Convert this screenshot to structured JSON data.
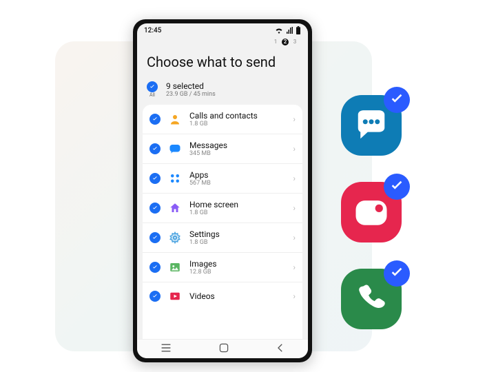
{
  "statusbar": {
    "time": "12:45"
  },
  "stepper": {
    "steps": [
      "1",
      "2",
      "3"
    ],
    "current": 1
  },
  "title": "Choose what to send",
  "select_all": {
    "all_label": "All",
    "count_label": "9 selected",
    "size_label": "23.9 GB / 45 mins"
  },
  "items": [
    {
      "name": "calls",
      "label": "Calls and contacts",
      "size": "1.8 GB",
      "icon": "contacts-icon",
      "color": "#f5a623"
    },
    {
      "name": "messages",
      "label": "Messages",
      "size": "345 MB",
      "icon": "messages-icon",
      "color": "#1b88ff"
    },
    {
      "name": "apps",
      "label": "Apps",
      "size": "567 MB",
      "icon": "apps-icon",
      "color": "#1b88ff"
    },
    {
      "name": "home",
      "label": "Home screen",
      "size": "1.8 GB",
      "icon": "home-icon",
      "color": "#8a5cf6"
    },
    {
      "name": "settings",
      "label": "Settings",
      "size": "1.8 GB",
      "icon": "settings-icon",
      "color": "#4aa3e0"
    },
    {
      "name": "images",
      "label": "Images",
      "size": "12.8 GB",
      "icon": "images-icon",
      "color": "#5ab562"
    },
    {
      "name": "videos",
      "label": "Videos",
      "size": "",
      "icon": "videos-icon",
      "color": "#e6264e"
    }
  ],
  "float": [
    {
      "name": "messages-app",
      "color": "blue"
    },
    {
      "name": "camera-app",
      "color": "red"
    },
    {
      "name": "phone-app",
      "color": "green"
    }
  ]
}
